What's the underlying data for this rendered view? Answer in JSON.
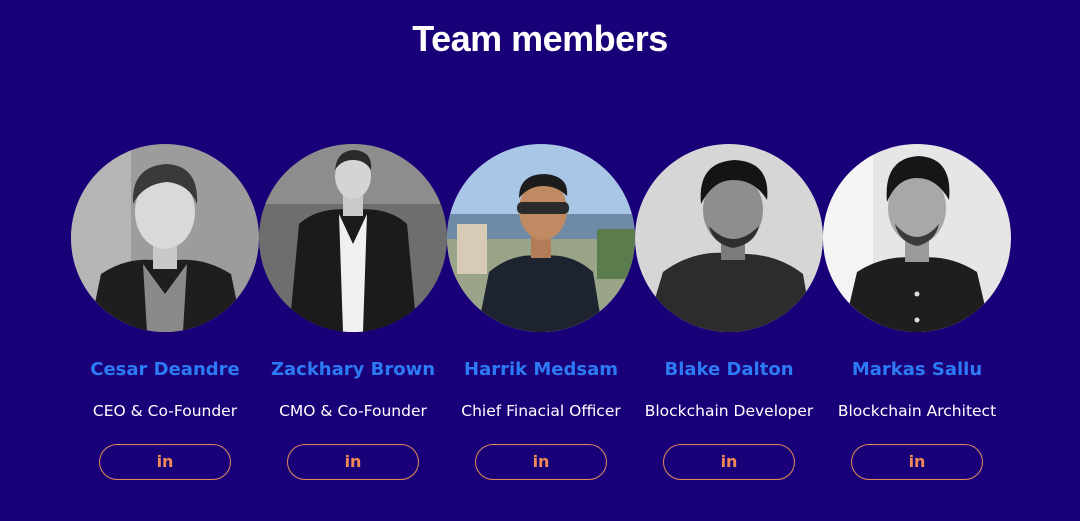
{
  "section": {
    "title": "Team members"
  },
  "members": [
    {
      "name": "Cesar Deandre",
      "role": "CEO & Co-Founder",
      "link_label": "in",
      "link_icon": "linkedin-icon"
    },
    {
      "name": "Zackhary Brown",
      "role": "CMO & Co-Founder",
      "link_label": "in",
      "link_icon": "linkedin-icon"
    },
    {
      "name": "Harrik Medsam",
      "role": "Chief Finacial Officer",
      "link_label": "in",
      "link_icon": "linkedin-icon"
    },
    {
      "name": "Blake Dalton",
      "role": "Blockchain Developer",
      "link_label": "in",
      "link_icon": "linkedin-icon"
    },
    {
      "name": "Markas Sallu",
      "role": "Blockchain Architect",
      "link_label": "in",
      "link_icon": "linkedin-icon"
    }
  ],
  "colors": {
    "background": "#1a0078",
    "name": "#2d7bf4",
    "role": "#ffffff",
    "accent": "#ef8a57"
  }
}
